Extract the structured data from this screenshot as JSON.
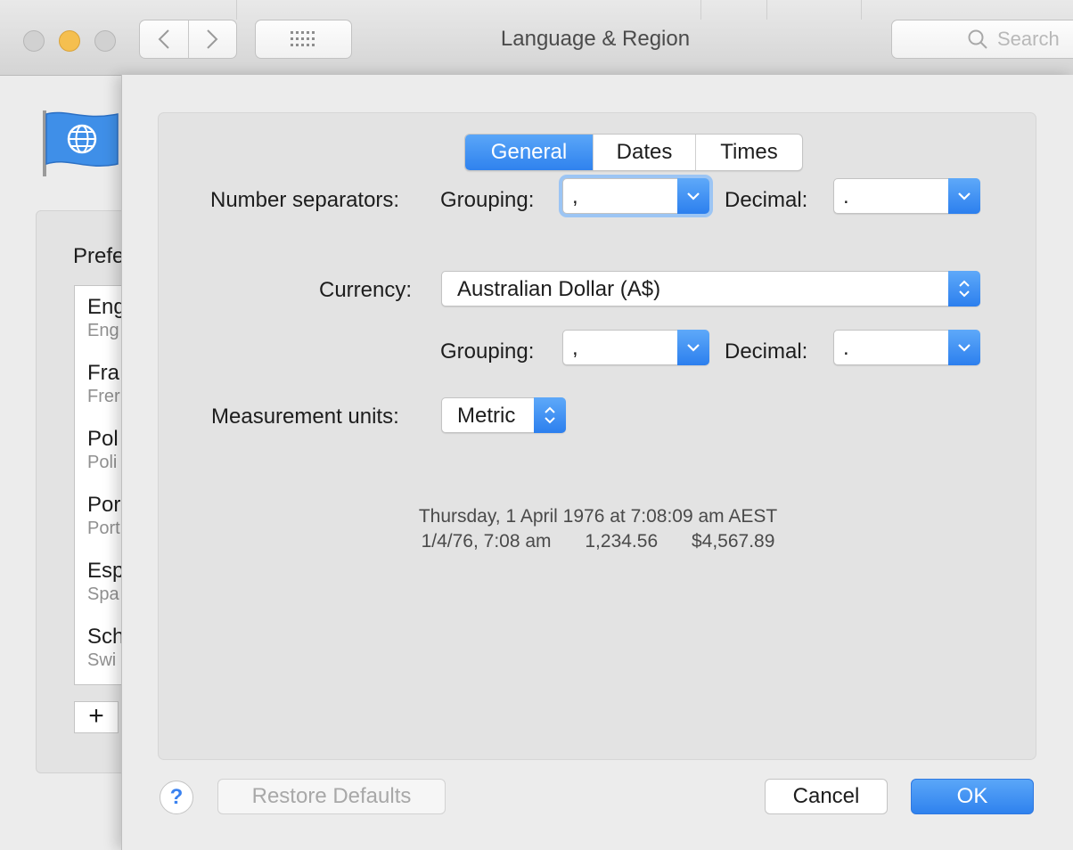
{
  "window": {
    "title": "Language & Region",
    "search_placeholder": "Search"
  },
  "background_pane": {
    "list_heading": "Prefe",
    "languages": [
      {
        "name": "Eng",
        "sub": "Eng"
      },
      {
        "name": "Fra",
        "sub": "Frer"
      },
      {
        "name": "Pol",
        "sub": "Poli"
      },
      {
        "name": "Por",
        "sub": "Port"
      },
      {
        "name": "Esp",
        "sub": "Spa"
      },
      {
        "name": "Sch",
        "sub": "Swi"
      }
    ],
    "add_label": "+"
  },
  "sheet": {
    "tabs": [
      {
        "label": "General",
        "selected": true
      },
      {
        "label": "Dates",
        "selected": false
      },
      {
        "label": "Times",
        "selected": false
      }
    ],
    "number_separators": {
      "label": "Number separators:",
      "grouping_label": "Grouping:",
      "grouping_value": ",",
      "decimal_label": "Decimal:",
      "decimal_value": "."
    },
    "currency": {
      "label": "Currency:",
      "value": "Australian Dollar (A$)",
      "grouping_label": "Grouping:",
      "grouping_value": ",",
      "decimal_label": "Decimal:",
      "decimal_value": "."
    },
    "measurement": {
      "label": "Measurement units:",
      "value": "Metric"
    },
    "sample": {
      "line1": "Thursday, 1 April 1976 at 7:08:09 am AEST",
      "short_date": "1/4/76, 7:08 am",
      "number": "1,234.56",
      "currency": "$4,567.89"
    },
    "buttons": {
      "help": "?",
      "restore": "Restore Defaults",
      "cancel": "Cancel",
      "ok": "OK"
    }
  },
  "colors": {
    "accent": "#2f82ee",
    "focus_ring": "#9cc5f4",
    "minimize": "#f5bf4f"
  }
}
